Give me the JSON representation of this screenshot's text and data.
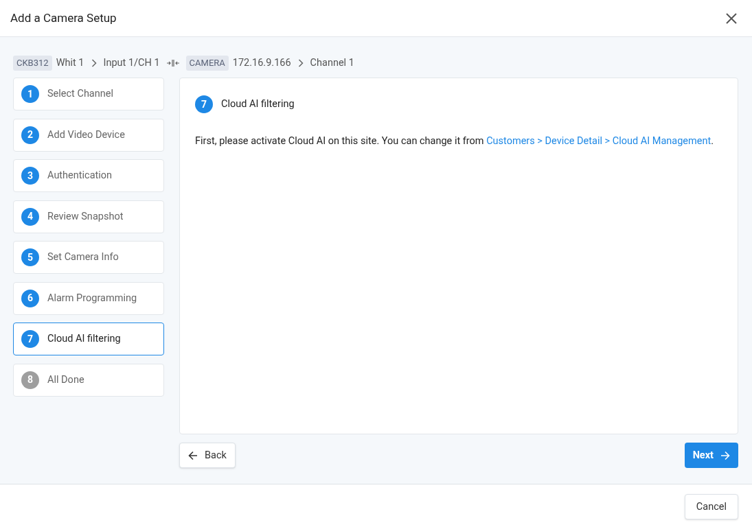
{
  "window": {
    "title": "Add a Camera Setup"
  },
  "breadcrumb": [
    {
      "kind": "tag",
      "text": "CKB312"
    },
    {
      "kind": "text",
      "text": "Whit 1"
    },
    {
      "kind": "chevron"
    },
    {
      "kind": "text",
      "text": "Input 1/CH 1"
    },
    {
      "kind": "connector"
    },
    {
      "kind": "tag",
      "text": "CAMERA"
    },
    {
      "kind": "text",
      "text": "172.16.9.166"
    },
    {
      "kind": "chevron"
    },
    {
      "kind": "text",
      "text": "Channel 1"
    }
  ],
  "steps": [
    {
      "number": "1",
      "label": "Select Channel",
      "selected": false,
      "disabled": false
    },
    {
      "number": "2",
      "label": "Add Video Device",
      "selected": false,
      "disabled": false
    },
    {
      "number": "3",
      "label": "Authentication",
      "selected": false,
      "disabled": false
    },
    {
      "number": "4",
      "label": "Review Snapshot",
      "selected": false,
      "disabled": false
    },
    {
      "number": "5",
      "label": "Set Camera Info",
      "selected": false,
      "disabled": false
    },
    {
      "number": "6",
      "label": "Alarm Programming",
      "selected": false,
      "disabled": false
    },
    {
      "number": "7",
      "label": "Cloud AI filtering",
      "selected": true,
      "disabled": false
    },
    {
      "number": "8",
      "label": "All Done",
      "selected": false,
      "disabled": true
    }
  ],
  "panel": {
    "number": "7",
    "title": "Cloud AI filtering",
    "message": "First, please activate Cloud AI on this site. You can change it from ",
    "link": "Customers > Device Detail > Cloud AI Management",
    "message_end": "."
  },
  "back_button": "Back",
  "next_button": "Next",
  "cancel_button": "Cancel"
}
